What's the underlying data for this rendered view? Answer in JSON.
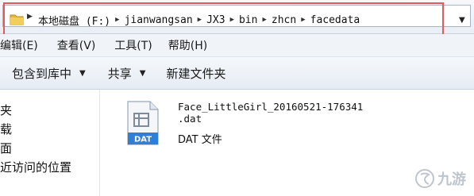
{
  "address_bar": {
    "crumbs": [
      "本地磁盘 (F:)",
      "jianwangsan",
      "JX3",
      "bin",
      "zhcn",
      "facedata"
    ]
  },
  "menu": {
    "items": [
      "编辑(E)",
      "查看(V)",
      "工具(T)",
      "帮助(H)"
    ]
  },
  "toolbar": {
    "include_library": "包含到库中",
    "share": "共享",
    "new_folder": "新建文件夹"
  },
  "nav": {
    "items": [
      "夹",
      "载",
      "面",
      "近访问的位置"
    ]
  },
  "file": {
    "name_line1": "Face_LittleGirl_20160521-176341",
    "name_line2": ".dat",
    "type": "DAT 文件",
    "icon_label": "DAT"
  },
  "watermark": {
    "text": "九游"
  },
  "colors": {
    "highlight_border": "#e25a5a",
    "dat_badge": "#2f7fd6"
  }
}
